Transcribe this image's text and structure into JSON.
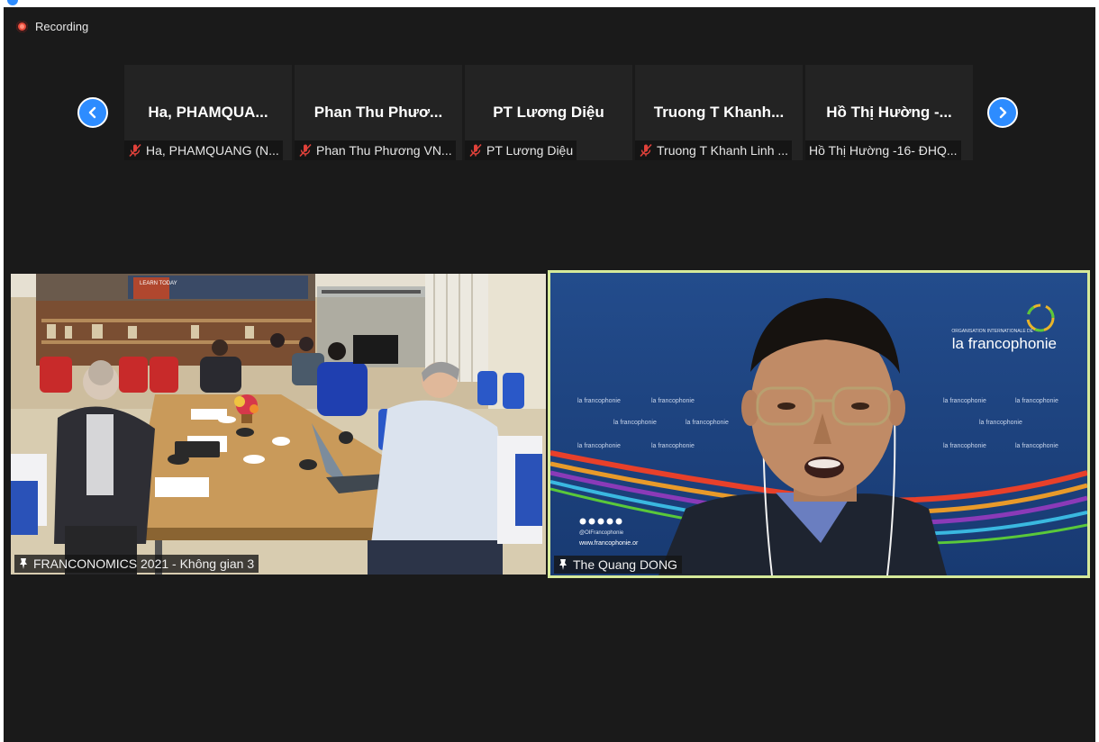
{
  "recording": {
    "label": "Recording"
  },
  "participant_strip": [
    {
      "name": "Ha,  PHAMQUA...",
      "label": "Ha, PHAMQUANG (N...",
      "muted": true
    },
    {
      "name": "Phan  Thu  Phươ...",
      "label": "Phan Thu Phương VN...",
      "muted": true
    },
    {
      "name": "PT Lương Diệu",
      "label": "PT Lương Diệu",
      "muted": true
    },
    {
      "name": "Truong  T  Khanh...",
      "label": "Truong T Khanh Linh ...",
      "muted": true
    },
    {
      "name": "Hồ  Thị  Hường  -...",
      "label": "Hồ Thị Hường -16- ĐHQ...",
      "muted": false
    }
  ],
  "videos": {
    "left": {
      "label": "FRANCONOMICS 2021 - Không gian 3"
    },
    "right": {
      "label": "The Quang DONG",
      "active_speaker": true
    }
  },
  "backdrop": {
    "org_line": "ORGANISATION INTERNATIONALE DE",
    "brand": "la francophonie",
    "small_brand": "la francophonie",
    "website": "www.francophonie.or",
    "handle": "@OIFrancophonie"
  },
  "room": {
    "poster_text": "LEARN TODAY"
  },
  "colors": {
    "background": "#1a1a1a",
    "accent": "#2d8cff",
    "active_border": "#d6ea9a",
    "recording": "#e84a3a",
    "muted": "#e0413a"
  },
  "icons": {
    "prev": "chevron-left-icon",
    "next": "chevron-right-icon",
    "muted": "mic-muted-icon",
    "pin": "pin-icon"
  }
}
